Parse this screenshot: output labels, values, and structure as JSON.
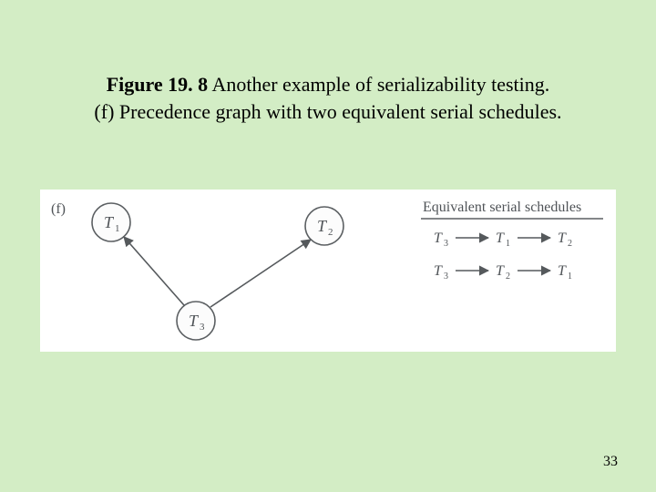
{
  "caption": {
    "figure_label": "Figure 19. 8",
    "title_rest": "Another example of serializability testing.",
    "subcaption": "(f) Precedence graph with two equivalent serial schedules."
  },
  "figure": {
    "part_label": "(f)",
    "nodes": {
      "t1": "T",
      "t1_sub": "1",
      "t2": "T",
      "t2_sub": "2",
      "t3": "T",
      "t3_sub": "3"
    },
    "schedules_header": "Equivalent serial schedules",
    "schedules": {
      "row1": {
        "a": "T",
        "a_sub": "3",
        "b": "T",
        "b_sub": "1",
        "c": "T",
        "c_sub": "2"
      },
      "row2": {
        "a": "T",
        "a_sub": "3",
        "b": "T",
        "b_sub": "2",
        "c": "T",
        "c_sub": "1"
      }
    }
  },
  "page_number": "33"
}
